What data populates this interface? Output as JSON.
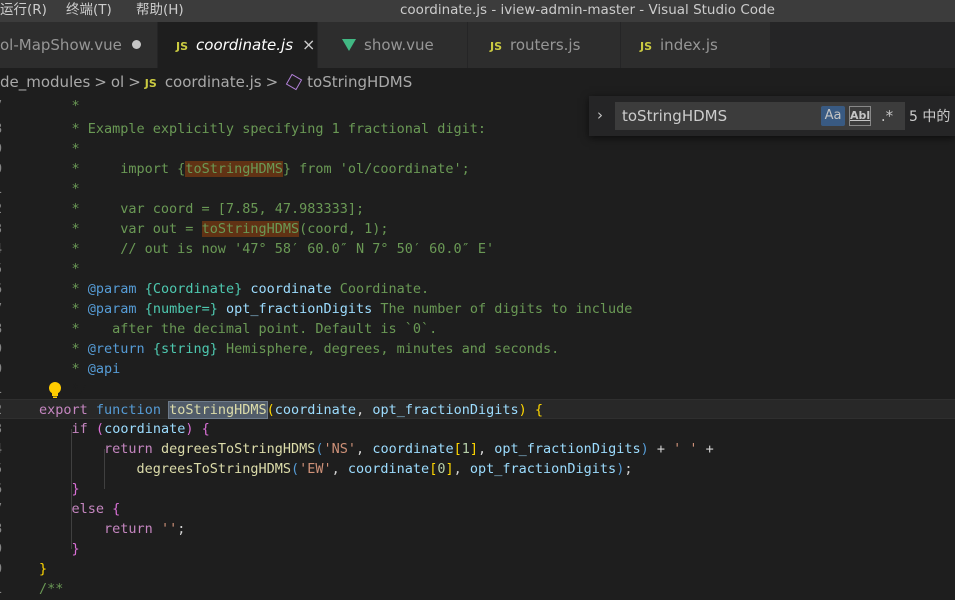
{
  "menu": {
    "items": [
      "运行(R)",
      "终端(T)",
      "帮助(H)"
    ]
  },
  "window": {
    "title": "coordinate.js - iview-admin-master - Visual Studio Code"
  },
  "tabs": [
    {
      "label": "ol-MapShow.vue",
      "kind": "vue",
      "dirty": true,
      "active": false
    },
    {
      "label": "coordinate.js",
      "kind": "js",
      "dirty": false,
      "active": true
    },
    {
      "label": "show.vue",
      "kind": "vue",
      "dirty": false,
      "active": false
    },
    {
      "label": "routers.js",
      "kind": "js",
      "dirty": false,
      "active": false
    },
    {
      "label": "index.js",
      "kind": "js",
      "dirty": false,
      "active": false
    }
  ],
  "file_icon_label": "JS",
  "close_glyph": "×",
  "breadcrumb": {
    "items": [
      "de_modules",
      "ol",
      "coordinate.js",
      "toStringHDMS"
    ],
    "separator": ">"
  },
  "find": {
    "value": "toStringHDMS",
    "toggle": "›",
    "match_case": "Aa",
    "whole_word": "Abl",
    "regex": ".*",
    "result": "5 中的"
  },
  "line_numbers": [
    "7",
    "8",
    "9",
    "0",
    "1",
    "2",
    "3",
    "4",
    "5",
    "6",
    "7",
    "8",
    "9",
    "0",
    "1",
    "2",
    "3",
    "4",
    "5",
    "6",
    "7",
    "8",
    "9",
    "0",
    "1"
  ],
  "code": {
    "l1": "    *",
    "l2": "    * Example explicitly specifying 1 fractional digit:",
    "l3": "    *",
    "l4_a": "    *     import {",
    "l4_b": "toStringHDMS",
    "l4_c": "} from 'ol/coordinate';",
    "l5": "    *",
    "l6": "    *     var coord = [7.85, 47.983333];",
    "l7_a": "    *     var out = ",
    "l7_b": "toStringHDMS",
    "l7_c": "(coord, 1);",
    "l8": "    *     // out is now '47° 58′ 60.0″ N 7° 50′ 60.0″ E'",
    "l9": "    *",
    "l10_a": "    * ",
    "l10_tag": "@param",
    "l10_type": " {Coordinate}",
    "l10_name": " coordinate",
    "l10_desc": " Coordinate.",
    "l11_a": "    * ",
    "l11_tag": "@param",
    "l11_type": " {number=}",
    "l11_name": " opt_fractionDigits",
    "l11_desc": " The number of digits to include",
    "l12": "    *    after the decimal point. Default is `0`.",
    "l13_a": "    * ",
    "l13_tag": "@return",
    "l13_type": " {string}",
    "l13_desc": " Hemisphere, degrees, minutes and seconds.",
    "l14_a": "    * ",
    "l14_tag": "@api",
    "l15": "    */",
    "kw_export": "export",
    "kw_function": "function",
    "fn_name": "toStringHDMS",
    "param1": "coordinate",
    "param2": "opt_fractionDigits",
    "kw_if": "if",
    "kw_return": "return",
    "kw_else": "else",
    "fn_deg": "degreesToStringHDMS",
    "str_ns": "'NS'",
    "str_ew": "'EW'",
    "num_1": "1",
    "num_0": "0",
    "str_space": "' '",
    "str_empty": "''",
    "last": "/**"
  }
}
